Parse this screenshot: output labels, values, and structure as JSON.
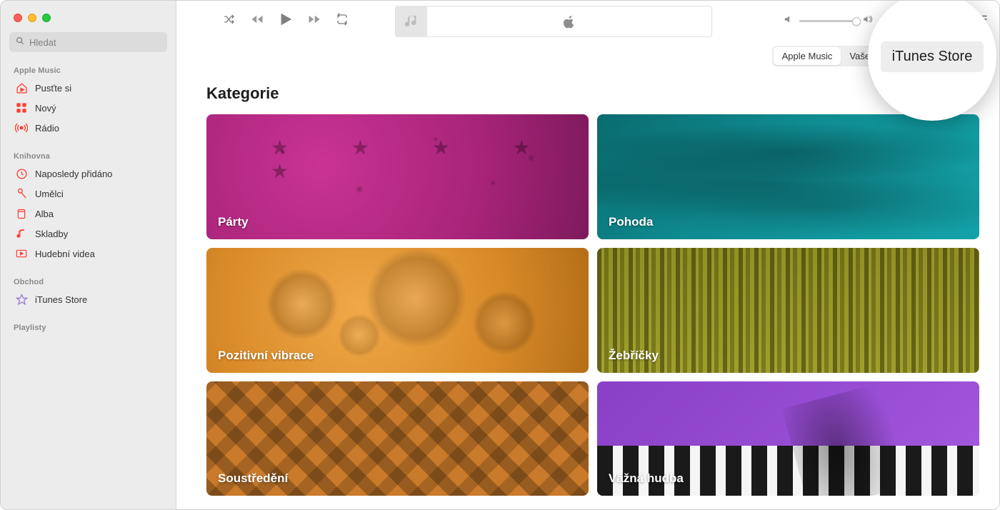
{
  "search": {
    "placeholder": "Hledat"
  },
  "sidebar": {
    "sections": [
      {
        "heading": "Apple Music",
        "items": [
          {
            "label": "Pusťte si",
            "icon": "play-home"
          },
          {
            "label": "Nový",
            "icon": "grid"
          },
          {
            "label": "Rádio",
            "icon": "radio"
          }
        ]
      },
      {
        "heading": "Knihovna",
        "items": [
          {
            "label": "Naposledy přidáno",
            "icon": "clock"
          },
          {
            "label": "Umělci",
            "icon": "mic"
          },
          {
            "label": "Alba",
            "icon": "album"
          },
          {
            "label": "Skladby",
            "icon": "note"
          },
          {
            "label": "Hudební videa",
            "icon": "video"
          }
        ]
      },
      {
        "heading": "Obchod",
        "items": [
          {
            "label": "iTunes Store",
            "icon": "star"
          }
        ]
      },
      {
        "heading": "Playlisty",
        "items": []
      }
    ]
  },
  "segmented": {
    "apple_music": "Apple Music",
    "library": "Vaše knihovna",
    "store": "iTunes Store"
  },
  "content": {
    "heading": "Kategorie",
    "tiles": [
      {
        "label": "Párty"
      },
      {
        "label": "Pohoda"
      },
      {
        "label": "Pozitivní vibrace"
      },
      {
        "label": "Žebříčky"
      },
      {
        "label": "Soustředění"
      },
      {
        "label": "Vážná hudba"
      }
    ]
  },
  "callout": {
    "label": "iTunes Store"
  }
}
